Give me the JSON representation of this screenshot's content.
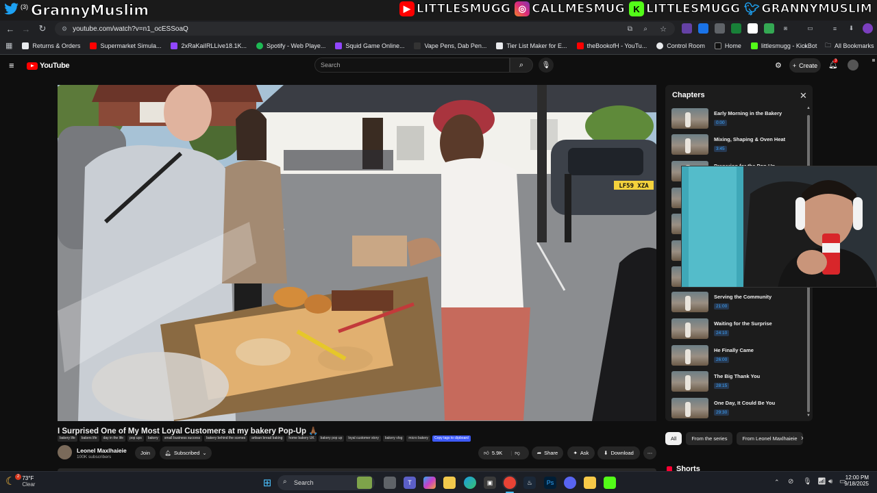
{
  "stream_overlay": {
    "left_handle": "GrannyMuslim",
    "left_badge": "(3)",
    "right_handles": [
      {
        "platform": "youtube",
        "icon": "youtube-icon",
        "name": "LITTLESMUGG",
        "color": "#ff0000"
      },
      {
        "platform": "instagram",
        "icon": "instagram-icon",
        "name": "CALLMESMUG",
        "color": "#e1306c"
      },
      {
        "platform": "kick",
        "icon": "kick-icon",
        "name": "LITTLESMUGG",
        "color": "#53fc18"
      },
      {
        "platform": "twitter",
        "icon": "twitter-icon",
        "name": "GRANNYMUSLIM",
        "color": "#1da1f2"
      }
    ]
  },
  "browser": {
    "url": "youtube.com/watch?v=n1_ocESSoaQ",
    "bookmarks": [
      {
        "label": "Returns & Orders",
        "color": "#e8eaed"
      },
      {
        "label": "Supermarket Simula...",
        "color": "#ff0000"
      },
      {
        "label": "2xRaKaiIRLLive18.1K...",
        "color": "#9146ff"
      },
      {
        "label": "Spotify - Web Playe...",
        "color": "#1db954"
      },
      {
        "label": "Squid Game Online...",
        "color": "#9146ff"
      },
      {
        "label": "Vape Pens, Dab Pen...",
        "color": "#333333"
      },
      {
        "label": "Tier List Maker for E...",
        "color": "#e8eaed"
      },
      {
        "label": "theBookofH - YouTu...",
        "color": "#ff0000"
      },
      {
        "label": "Control Room",
        "color": "#e8eaed"
      },
      {
        "label": "Home",
        "color": "#111111"
      },
      {
        "label": "littlesmugg - KickBot",
        "color": "#53fc18"
      }
    ],
    "all_bookmarks": "All Bookmarks"
  },
  "youtube": {
    "logo_text": "YouTube",
    "search_placeholder": "Search",
    "create_label": "Create",
    "notif_count": "3",
    "video": {
      "title": "I Surprised One of My Most Loyal Customers at my bakery Pop-Up 🙏🏾",
      "tags": [
        "bakery life",
        "bakers life",
        "day in the life",
        "pop ups",
        "bakery",
        "small business success",
        "bakery behind the scenes",
        "artisan bread baking",
        "home bakery UK",
        "bakery pop up",
        "loyal customer story",
        "bakery vlog",
        "micro bakery"
      ],
      "copy_tags": "Copy tags to clipboard",
      "channel": "Leonel Maxlhaieie",
      "subscribers": "100K subscribers",
      "join": "Join",
      "subscribed": "Subscribed",
      "likes": "5.9K",
      "share": "Share",
      "ask": "Ask",
      "download": "Download",
      "plate": "LF59 XZA"
    },
    "chapters_title": "Chapters",
    "chapters": [
      {
        "title": "Early Morning in the Bakery",
        "time": "0:00"
      },
      {
        "title": "Mixing, Shaping & Oven Heat",
        "time": "3:45"
      },
      {
        "title": "Preparing for the Pop-Up",
        "time": ""
      },
      {
        "title": "",
        "time": ""
      },
      {
        "title": "",
        "time": ""
      },
      {
        "title": "",
        "time": ""
      },
      {
        "title": "",
        "time": ""
      },
      {
        "title": "Serving the Community",
        "time": "21:00"
      },
      {
        "title": "Waiting for the Surprise",
        "time": "24:10"
      },
      {
        "title": "He Finally Came",
        "time": "26:00"
      },
      {
        "title": "The Big Thank You",
        "time": "28:15"
      },
      {
        "title": "One Day, It Could Be You",
        "time": "29:30"
      }
    ],
    "filters": [
      "All",
      "From the series",
      "From Leonel Maxlhaieie"
    ],
    "shorts_label": "Shorts"
  },
  "taskbar": {
    "weather_temp": "73°F",
    "weather_desc": "Clear",
    "weather_badge": "2",
    "search_label": "Search",
    "time": "12:00 PM",
    "date": "9/18/2025"
  }
}
